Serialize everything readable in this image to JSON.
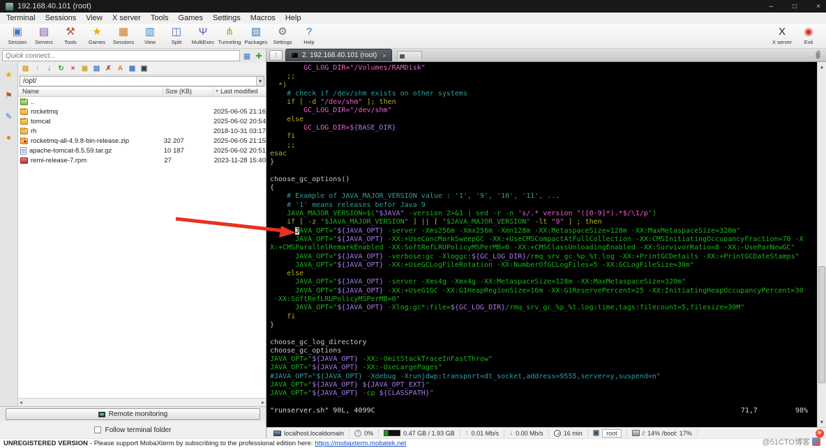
{
  "window": {
    "title": "192.168.40.101 (root)",
    "minimize": "–",
    "maximize": "□",
    "close": "×"
  },
  "menu": {
    "items": [
      "Terminal",
      "Sessions",
      "View",
      "X server",
      "Tools",
      "Games",
      "Settings",
      "Macros",
      "Help"
    ]
  },
  "toolbar": {
    "items": [
      {
        "name": "session",
        "label": "Session",
        "glyph": "▣",
        "color": "#3c78c0"
      },
      {
        "name": "servers",
        "label": "Servers",
        "glyph": "▤",
        "color": "#8055a8"
      },
      {
        "name": "tools",
        "label": "Tools",
        "glyph": "⚒",
        "color": "#c04a30"
      },
      {
        "name": "games",
        "label": "Games",
        "glyph": "★",
        "color": "#e8b000"
      },
      {
        "name": "sessions",
        "label": "Sessions",
        "glyph": "▦",
        "color": "#d07818"
      },
      {
        "name": "view",
        "label": "View",
        "glyph": "▥",
        "color": "#3888c8"
      },
      {
        "name": "split",
        "label": "Split",
        "glyph": "◫",
        "color": "#4068b8"
      },
      {
        "name": "multiexec",
        "label": "MultiExec",
        "glyph": "Ψ",
        "color": "#7a48b0"
      },
      {
        "name": "tunneling",
        "label": "Tunneling",
        "glyph": "⋔",
        "color": "#a8a818"
      },
      {
        "name": "packages",
        "label": "Packages",
        "glyph": "▧",
        "color": "#3878b8"
      },
      {
        "name": "settings",
        "label": "Settings",
        "glyph": "⚙",
        "color": "#687078"
      },
      {
        "name": "help",
        "label": "Help",
        "glyph": "?",
        "color": "#2878c8"
      }
    ],
    "right": [
      {
        "name": "xserver",
        "label": "X server",
        "glyph": "X",
        "color": "#202830"
      },
      {
        "name": "exit",
        "label": "Exit",
        "glyph": "◉",
        "color": "#d83020"
      }
    ]
  },
  "quick_connect": {
    "placeholder": "Quick connect..."
  },
  "side_tabs": [
    {
      "name": "sessions",
      "glyph": "★",
      "color": "#e8b000"
    },
    {
      "name": "tools",
      "glyph": "⚑",
      "color": "#c05030"
    },
    {
      "name": "macros",
      "glyph": "✎",
      "color": "#3878c8"
    },
    {
      "name": "sftp",
      "glyph": "●",
      "color": "#e08818"
    }
  ],
  "sftp": {
    "toolbar": [
      {
        "name": "parent-folder",
        "glyph": "▨",
        "color": "#d8a020"
      },
      {
        "name": "upload",
        "glyph": "↑",
        "color": "#d89010"
      },
      {
        "name": "download",
        "glyph": "↓",
        "color": "#2f6fd0"
      },
      {
        "name": "refresh",
        "glyph": "↻",
        "color": "#2fa030"
      },
      {
        "name": "stop",
        "glyph": "×",
        "color": "#d03030"
      },
      {
        "name": "new-folder",
        "glyph": "▣",
        "color": "#e0a818"
      },
      {
        "name": "document",
        "glyph": "▤",
        "color": "#4878d0"
      },
      {
        "name": "delete",
        "glyph": "✗",
        "color": "#c03028"
      },
      {
        "name": "rename",
        "glyph": "A",
        "color": "#e07818"
      },
      {
        "name": "grid-view",
        "glyph": "▦",
        "color": "#4878d0"
      },
      {
        "name": "terminal-sync",
        "glyph": "▣",
        "color": "#30383f"
      }
    ],
    "path": "/opt/",
    "headers": {
      "name": "Name",
      "size": "Size (KB)",
      "modified": "Last modified"
    },
    "rows": [
      {
        "icon": "folder-up",
        "name": "..",
        "size": "",
        "modified": ""
      },
      {
        "icon": "folder",
        "name": "rocketmq",
        "size": "",
        "modified": "2025-06-05 21:16"
      },
      {
        "icon": "folder",
        "name": "tomcat",
        "size": "",
        "modified": "2025-06-02 20:54"
      },
      {
        "icon": "folder",
        "name": "rh",
        "size": "",
        "modified": "2018-10-31 03:17"
      },
      {
        "icon": "zip",
        "name": "rocketmq-all-4.9.8-bin-release.zip",
        "size": "32 207",
        "modified": "2025-06-05 21:15"
      },
      {
        "icon": "gz",
        "name": "apache-tomcat-8.5.59.tar.gz",
        "size": "10 187",
        "modified": "2025-06-02 20:51"
      },
      {
        "icon": "rpm",
        "name": "remi-release-7.rpm",
        "size": "27",
        "modified": "2023-11-28 15:40"
      }
    ],
    "remote_monitoring_label": "Remote monitoring",
    "follow_label": "Follow terminal folder"
  },
  "tabbar": {
    "active_label": "2. 192.168.40.101 (root)"
  },
  "terminal": {
    "colors": {
      "background": "#000000",
      "comment": "#2f9e9e",
      "keyword": "#b3b326",
      "string": "#ef5fd0",
      "green": "#1cb21c",
      "variable": "#a77ae8",
      "text": "#c9c9c9"
    },
    "lines": [
      [
        {
          "c": "str",
          "t": "        GC_LOG_DIR=\"/Volumes/RAMDisk\""
        }
      ],
      [
        {
          "c": "kw",
          "t": "    ;;"
        }
      ],
      [
        {
          "c": "kw",
          "t": "  *)"
        }
      ],
      [
        {
          "c": "com",
          "t": "    # check if /dev/shm exists on other systems"
        }
      ],
      [
        {
          "c": "kw",
          "t": "    if [ -d "
        },
        {
          "c": "str",
          "t": "\"/dev/shm\""
        },
        {
          "c": "kw",
          "t": " ]; then"
        }
      ],
      [
        {
          "c": "str",
          "t": "        GC_LOG_DIR=\"/dev/shm\""
        }
      ],
      [
        {
          "c": "kw",
          "t": "    else"
        }
      ],
      [
        {
          "c": "str",
          "t": "        GC_LOG_DIR="
        },
        {
          "c": "var",
          "t": "${BASE_DIR}"
        }
      ],
      [
        {
          "c": "kw",
          "t": "    fi"
        }
      ],
      [
        {
          "c": "kw",
          "t": "    ;;"
        }
      ],
      [
        {
          "c": "kw",
          "t": "esac"
        }
      ],
      [
        {
          "c": "txt",
          "t": "}"
        }
      ],
      [],
      [
        {
          "c": "txt",
          "t": "choose_gc_options()"
        }
      ],
      [
        {
          "c": "txt",
          "t": "{"
        }
      ],
      [
        {
          "c": "com",
          "t": "    # Example of JAVA_MAJOR_VERSION value : '1', '9', '10', '11', ..."
        }
      ],
      [
        {
          "c": "com",
          "t": "    # '1' means releases befor Java 9"
        }
      ],
      [
        {
          "c": "grn",
          "t": "    JAVA_MAJOR_VERSION=$("
        },
        {
          "c": "var",
          "t": "\"$JAVA\""
        },
        {
          "c": "grn",
          "t": " -version 2>&1 | sed -r -n "
        },
        {
          "c": "str",
          "t": "'s/.* version \"([0-9]*).*$/\\1/p'"
        },
        {
          "c": "grn",
          "t": ")"
        }
      ],
      [
        {
          "c": "kw",
          "t": "    if [ -z "
        },
        {
          "c": "grn",
          "t": "\"$JAVA_MAJOR_VERSION\""
        },
        {
          "c": "kw",
          "t": " ] || [ "
        },
        {
          "c": "grn",
          "t": "\"$JAVA_MAJOR_VERSION\""
        },
        {
          "c": "kw",
          "t": " -lt "
        },
        {
          "c": "str",
          "t": "\"9\""
        },
        {
          "c": "kw",
          "t": " ] ; then"
        }
      ],
      [
        {
          "c": "grn",
          "t": "      "
        },
        {
          "c": "cur",
          "t": "J"
        },
        {
          "c": "grn",
          "t": "AVA_OPT=\""
        },
        {
          "c": "var",
          "t": "${JAVA_OPT}"
        },
        {
          "c": "grn",
          "t": " -server -Xms256m -Xmx256m -Xmn128m -XX:MetaspaceSize=128m -XX:MaxMetaspaceSize=320m\""
        }
      ],
      [
        {
          "c": "grn",
          "t": "      JAVA_OPT=\""
        },
        {
          "c": "var",
          "t": "${JAVA_OPT}"
        },
        {
          "c": "grn",
          "t": " -XX:+UseConcMarkSweepGC -XX:+UseCMSCompactAtFullCollection -XX:CMSInitiatingOccupancyFraction=70 -X"
        }
      ],
      [
        {
          "c": "grn",
          "t": "X:+CMSParallelRemarkEnabled -XX:SoftRefLRUPolicyMSPerMB=0 -XX:+CMSClassUnloadingEnabled -XX:SurvivorRatio=8 -XX:-UseParNewGC\""
        }
      ],
      [
        {
          "c": "grn",
          "t": "      JAVA_OPT=\""
        },
        {
          "c": "var",
          "t": "${JAVA_OPT}"
        },
        {
          "c": "grn",
          "t": " -verbose:gc -Xloggc:"
        },
        {
          "c": "var",
          "t": "${GC_LOG_DIR}"
        },
        {
          "c": "grn",
          "t": "/rmq_srv_gc_%p_%t.log -XX:+PrintGCDetails -XX:+PrintGCDateStamps\""
        }
      ],
      [
        {
          "c": "grn",
          "t": "      JAVA_OPT=\""
        },
        {
          "c": "var",
          "t": "${JAVA_OPT}"
        },
        {
          "c": "grn",
          "t": " -XX:+UseGCLogFileRotation -XX:NumberOfGCLogFiles=5 -XX:GCLogFileSize=30m\""
        }
      ],
      [
        {
          "c": "kw",
          "t": "    else"
        }
      ],
      [
        {
          "c": "grn",
          "t": "      JAVA_OPT=\""
        },
        {
          "c": "var",
          "t": "${JAVA_OPT}"
        },
        {
          "c": "grn",
          "t": " -server -Xms4g -Xmx4g -XX:MetaspaceSize=128m -XX:MaxMetaspaceSize=320m\""
        }
      ],
      [
        {
          "c": "grn",
          "t": "      JAVA_OPT=\""
        },
        {
          "c": "var",
          "t": "${JAVA_OPT}"
        },
        {
          "c": "grn",
          "t": " -XX:+UseG1GC -XX:G1HeapRegionSize=16m -XX:G1ReservePercent=25 -XX:InitiatingHeapOccupancyPercent=30"
        }
      ],
      [
        {
          "c": "grn",
          "t": " -XX:SoftRefLRUPolicyMSPerMB=0\""
        }
      ],
      [
        {
          "c": "grn",
          "t": "      JAVA_OPT=\""
        },
        {
          "c": "var",
          "t": "${JAVA_OPT}"
        },
        {
          "c": "grn",
          "t": " -Xlog:gc*:file="
        },
        {
          "c": "var",
          "t": "${GC_LOG_DIR}"
        },
        {
          "c": "grn",
          "t": "/rmq_srv_gc_%p_%t.log:time,tags:filecount=5,filesize=30M\""
        }
      ],
      [
        {
          "c": "kw",
          "t": "    fi"
        }
      ],
      [
        {
          "c": "txt",
          "t": "}"
        }
      ],
      [],
      [
        {
          "c": "txt",
          "t": "choose_gc_log_directory"
        }
      ],
      [
        {
          "c": "txt",
          "t": "choose_gc_options"
        }
      ],
      [
        {
          "c": "grn",
          "t": "JAVA_OPT=\""
        },
        {
          "c": "var",
          "t": "${JAVA_OPT}"
        },
        {
          "c": "grn",
          "t": " -XX:-OmitStackTraceInFastThrow\""
        }
      ],
      [
        {
          "c": "grn",
          "t": "JAVA_OPT=\""
        },
        {
          "c": "var",
          "t": "${JAVA_OPT}"
        },
        {
          "c": "grn",
          "t": " -XX:-UseLargePages\""
        }
      ],
      [
        {
          "c": "com",
          "t": "#JAVA_OPT=\"${JAVA_OPT} -Xdebug -Xrunjdwp:transport=dt_socket,address=9555,server=y,suspend=n\""
        }
      ],
      [
        {
          "c": "grn",
          "t": "JAVA_OPT=\""
        },
        {
          "c": "var",
          "t": "${JAVA_OPT}"
        },
        {
          "c": "grn",
          "t": " "
        },
        {
          "c": "var",
          "t": "${JAVA_OPT_EXT}"
        },
        {
          "c": "grn",
          "t": "\""
        }
      ],
      [
        {
          "c": "grn",
          "t": "JAVA_OPT=\""
        },
        {
          "c": "var",
          "t": "${JAVA_OPT}"
        },
        {
          "c": "grn",
          "t": " -cp "
        },
        {
          "c": "var",
          "t": "${CLASSPATH}"
        },
        {
          "c": "grn",
          "t": "\""
        }
      ],
      []
    ],
    "status": {
      "left": "\"runserver.sh\" 90L, 4099C",
      "position": "71,7",
      "percent": "98%"
    }
  },
  "statusbar": {
    "items": [
      {
        "name": "host",
        "icon": "host-icon",
        "text": "localhost.localdomain"
      },
      {
        "name": "cpu",
        "icon": "cpu-gauge-icon",
        "text": "0%"
      },
      {
        "name": "memory",
        "icon": "memory-bar-icon",
        "text": "0.47 GB / 1.93 GB"
      },
      {
        "name": "upload-speed",
        "glyph": "↑",
        "color": "#e09010",
        "text": "0.01 Mb/s"
      },
      {
        "name": "download-speed",
        "glyph": "↓",
        "color": "#38a038",
        "text": "0.00 Mb/s"
      },
      {
        "name": "uptime",
        "icon": "clock-icon",
        "text": "16 min"
      },
      {
        "name": "user",
        "glyph": "▣",
        "color": "#3a4e5f",
        "text": "root",
        "boxed": true
      },
      {
        "name": "disk",
        "icon": "disk-icon",
        "text": "/: 14%   /boot: 17%"
      }
    ]
  },
  "footer": {
    "bold": "UNREGISTERED VERSION",
    "text": " -  Please support MobaXterm by subscribing to the professional edition here: ",
    "link": "https://mobaxterm.mobatek.net"
  },
  "watermark": {
    "text": "@51CTO博客"
  }
}
